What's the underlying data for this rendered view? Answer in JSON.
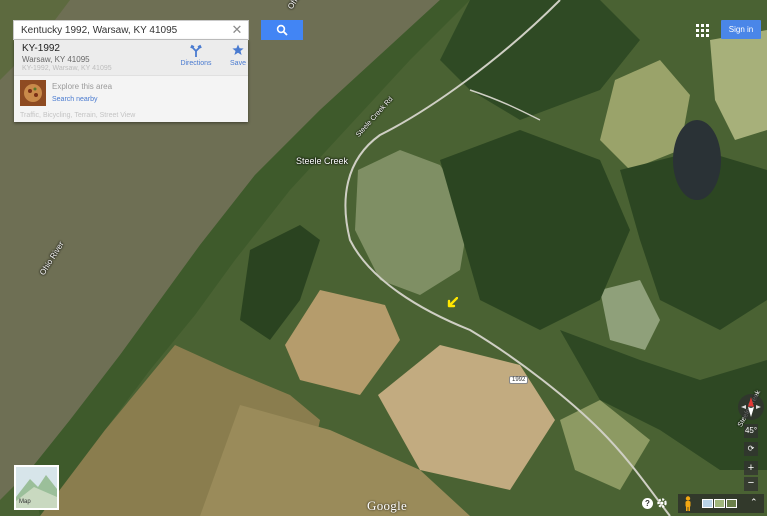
{
  "search": {
    "value": "Kentucky 1992, Warsaw, KY 41095",
    "clear_glyph": "✕",
    "button_icon": "search-icon"
  },
  "place_card": {
    "title": "KY-1992",
    "address": "Warsaw, KY 41095",
    "address_faint": "KY-1992, Warsaw, KY 41095",
    "directions_label": "Directions",
    "directions_icon": "directions-icon",
    "save_label": "Save",
    "save_icon": "star-icon",
    "explore_title": "Explore this area",
    "search_nearby": "Search nearby",
    "faded_row": "Traffic, Bicycling, Terrain, Street View"
  },
  "header": {
    "apps_icon": "apps-grid-icon",
    "sign_in": "Sign in"
  },
  "map_labels": {
    "steele_creek": "Steele Creek",
    "steele_creek_rd": "Steele Creek Rd",
    "ohio_river": "Ohio River",
    "ohio_river_top": "Ohio River",
    "steele_creek_right": "Steele Creek",
    "route_1992": "1992"
  },
  "footer": {
    "map_toggle_label": "Map",
    "google": "Google",
    "help": "?",
    "expand": "⌃"
  },
  "controls": {
    "zoom_in": "+",
    "zoom_out": "−",
    "tilt": "45°",
    "rotate": "⟳"
  },
  "colors": {
    "river": "#6e6f54",
    "forest": "#2f4a24",
    "field_light": "#b9a57a",
    "accent_blue": "#4285f4"
  }
}
